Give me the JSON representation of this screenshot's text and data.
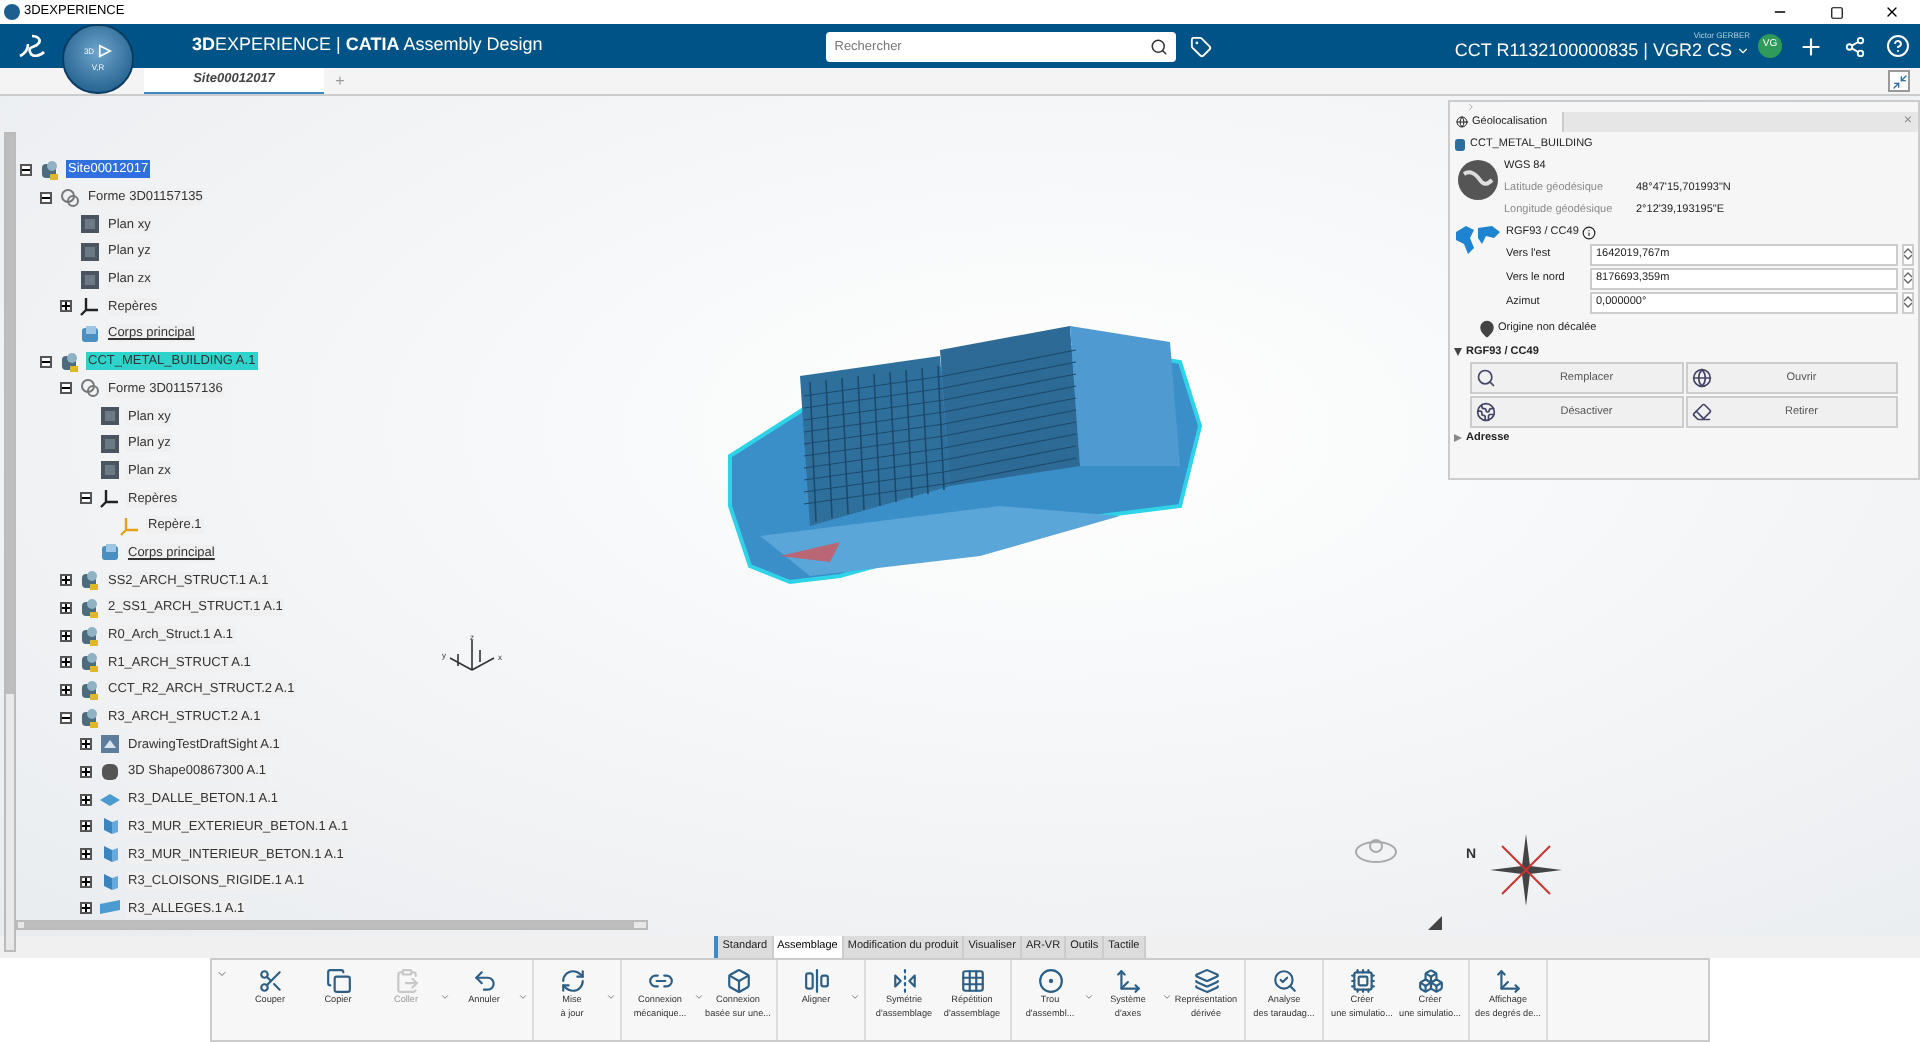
{
  "window": {
    "title": "3DEXPERIENCE"
  },
  "header": {
    "title": "**3D**EXPERIENCE | **CATIA** Assembly Design",
    "compass": {
      "left": "3D",
      "bottom": "V,R"
    },
    "search": {
      "placeholder": "Rechercher"
    },
    "user": "Victor GERBER",
    "context": "CCT R1132100000835 | VGR2 CS",
    "avatar": "VG"
  },
  "tabs": [
    {
      "label": "Site00012017",
      "selected": true
    },
    {
      "label": "+",
      "selected": false
    }
  ],
  "tree": [
    {
      "label": "Site00012017",
      "kind": "product",
      "selected": true,
      "highlighted": false,
      "expanded": true,
      "children": [
        {
          "label": "Forme 3D01157135",
          "kind": "shape",
          "selected": false,
          "highlighted": false,
          "expanded": true,
          "children": [
            {
              "label": "Plan xy",
              "kind": "plane",
              "selected": false,
              "highlighted": false
            },
            {
              "label": "Plan yz",
              "kind": "plane",
              "selected": false,
              "highlighted": false
            },
            {
              "label": "Plan zx",
              "kind": "plane",
              "selected": false,
              "highlighted": false
            },
            {
              "label": "Repères",
              "kind": "axes",
              "selected": false,
              "highlighted": false,
              "expanded": false
            },
            {
              "label": "Corps principal",
              "kind": "body",
              "selected": false,
              "highlighted": false
            }
          ]
        },
        {
          "label": "CCT_METAL_BUILDING A.1",
          "kind": "product",
          "selected": false,
          "highlighted": true,
          "expanded": true,
          "children": [
            {
              "label": "Forme 3D01157136",
              "kind": "shape",
              "selected": false,
              "highlighted": false,
              "expanded": true,
              "children": [
                {
                  "label": "Plan xy",
                  "kind": "plane",
                  "selected": false,
                  "highlighted": false
                },
                {
                  "label": "Plan yz",
                  "kind": "plane",
                  "selected": false,
                  "highlighted": false
                },
                {
                  "label": "Plan zx",
                  "kind": "plane",
                  "selected": false,
                  "highlighted": false
                },
                {
                  "label": "Repères",
                  "kind": "axes",
                  "selected": false,
                  "highlighted": false,
                  "expanded": true,
                  "children": [
                    {
                      "label": "Repère.1",
                      "kind": "axis",
                      "selected": false,
                      "highlighted": false
                    }
                  ]
                },
                {
                  "label": "Corps principal",
                  "kind": "body",
                  "selected": false,
                  "highlighted": false
                }
              ]
            },
            {
              "label": "SS2_ARCH_STRUCT.1 A.1",
              "kind": "product",
              "selected": false,
              "highlighted": false,
              "expanded": false
            },
            {
              "label": "2_SS1_ARCH_STRUCT.1 A.1",
              "kind": "product",
              "selected": false,
              "highlighted": false,
              "expanded": false
            },
            {
              "label": "R0_Arch_Struct.1 A.1",
              "kind": "product",
              "selected": false,
              "highlighted": false,
              "expanded": false
            },
            {
              "label": "R1_ARCH_STRUCT A.1",
              "kind": "product",
              "selected": false,
              "highlighted": false,
              "expanded": false
            },
            {
              "label": "CCT_R2_ARCH_STRUCT.2 A.1",
              "kind": "product",
              "selected": false,
              "highlighted": false,
              "expanded": false
            },
            {
              "label": "R3_ARCH_STRUCT.2 A.1",
              "kind": "product",
              "selected": false,
              "highlighted": false,
              "expanded": true,
              "children": [
                {
                  "label": "DrawingTestDraftSight A.1",
                  "kind": "drawing",
                  "selected": false,
                  "highlighted": false,
                  "expanded": false
                },
                {
                  "label": "3D Shape00867300 A.1",
                  "kind": "part",
                  "selected": false,
                  "highlighted": false,
                  "expanded": false
                },
                {
                  "label": "R3_DALLE_BETON.1 A.1",
                  "kind": "slab",
                  "selected": false,
                  "highlighted": false,
                  "expanded": false
                },
                {
                  "label": "R3_MUR_EXTERIEUR_BETON.1 A.1",
                  "kind": "wall",
                  "selected": false,
                  "highlighted": false,
                  "expanded": false
                },
                {
                  "label": "R3_MUR_INTERIEUR_BETON.1 A.1",
                  "kind": "wall",
                  "selected": false,
                  "highlighted": false,
                  "expanded": false
                },
                {
                  "label": "R3_CLOISONS_RIGIDE.1 A.1",
                  "kind": "wall",
                  "selected": false,
                  "highlighted": false,
                  "expanded": false
                },
                {
                  "label": "R3_ALLEGES.1 A.1",
                  "kind": "railing",
                  "selected": false,
                  "highlighted": false,
                  "expanded": false
                }
              ]
            }
          ]
        }
      ]
    }
  ],
  "viewport": {
    "axis_labels": {
      "z": "z",
      "x": "x",
      "y": "y"
    },
    "compass_label": "N"
  },
  "panel": {
    "title": "Géolocalisation",
    "close": "×",
    "object": "CCT_METAL_BUILDING",
    "system": "WGS 84",
    "coords": [
      {
        "label": "Latitude géodésique",
        "value": "48°47'15,701993\"N"
      },
      {
        "label": "Longitude géodésique",
        "value": "2°12'39,193195\"E"
      }
    ],
    "projection": "RGF93 / CC49",
    "fields": [
      {
        "label": "Vers l'est",
        "value": "1642019,767m"
      },
      {
        "label": "Vers le nord",
        "value": "8176693,359m"
      },
      {
        "label": "Azimut",
        "value": "0,000000°"
      }
    ],
    "origin": "Origine non décalée",
    "sections": [
      {
        "label": "RGF93 / CC49",
        "expanded": true,
        "buttons": [
          "Remplacer",
          "Ouvrir",
          "Désactiver",
          "Retirer"
        ]
      },
      {
        "label": "Adresse",
        "expanded": false
      }
    ]
  },
  "action_tabs": [
    {
      "label": "Standard",
      "selected": false
    },
    {
      "label": "Assemblage",
      "selected": true
    },
    {
      "label": "Modification du produit",
      "selected": false
    },
    {
      "label": "Visualiser",
      "selected": false
    },
    {
      "label": "AR-VR",
      "selected": false
    },
    {
      "label": "Outils",
      "selected": false
    },
    {
      "label": "Tactile",
      "selected": false
    }
  ],
  "toolbar": [
    {
      "items": [
        {
          "lines": [
            "Couper"
          ],
          "disabled": false,
          "dropdown": false
        },
        {
          "lines": [
            "Copier"
          ],
          "disabled": false,
          "dropdown": false
        },
        {
          "lines": [
            "Coller"
          ],
          "disabled": true,
          "dropdown": true
        },
        {
          "lines": [
            "Annuler"
          ],
          "disabled": false,
          "dropdown": true
        }
      ]
    },
    {
      "items": [
        {
          "lines": [
            "Mise",
            "à jour"
          ],
          "disabled": false,
          "dropdown": true
        }
      ]
    },
    {
      "items": [
        {
          "lines": [
            "Connexion",
            "mécanique..."
          ],
          "disabled": false,
          "dropdown": true
        },
        {
          "lines": [
            "Connexion",
            "basée sur une..."
          ],
          "disabled": false,
          "dropdown": false
        }
      ]
    },
    {
      "items": [
        {
          "lines": [
            "Aligner"
          ],
          "disabled": false,
          "dropdown": true
        }
      ]
    },
    {
      "items": [
        {
          "lines": [
            "Symétrie",
            "d'assemblage"
          ],
          "disabled": false,
          "dropdown": false
        },
        {
          "lines": [
            "Répétition",
            "d'assemblage"
          ],
          "disabled": false,
          "dropdown": false
        }
      ]
    },
    {
      "items": [
        {
          "lines": [
            "Trou",
            "d'assembl..."
          ],
          "disabled": false,
          "dropdown": true
        },
        {
          "lines": [
            "Système",
            "d'axes"
          ],
          "disabled": false,
          "dropdown": true
        },
        {
          "lines": [
            "Représentation",
            "dérivée"
          ],
          "disabled": false,
          "dropdown": false
        }
      ]
    },
    {
      "items": [
        {
          "lines": [
            "Analyse",
            "des taraudag..."
          ],
          "disabled": false,
          "dropdown": false
        }
      ]
    },
    {
      "items": [
        {
          "lines": [
            "Créer",
            "une simulatio..."
          ],
          "disabled": false,
          "dropdown": false
        },
        {
          "lines": [
            "Créer",
            "une simulatio..."
          ],
          "disabled": false,
          "dropdown": false
        }
      ]
    },
    {
      "items": [
        {
          "lines": [
            "Affichage",
            "des degrés de..."
          ],
          "disabled": false,
          "dropdown": false
        }
      ]
    }
  ]
}
